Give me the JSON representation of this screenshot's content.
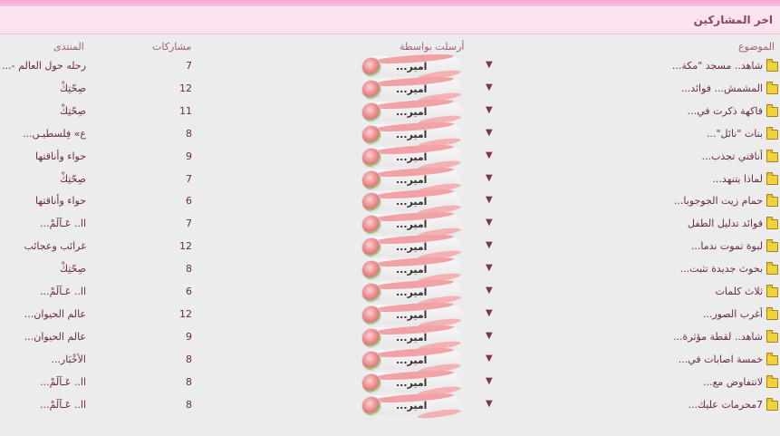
{
  "header": {
    "title": "اخر المشاركين"
  },
  "columns": {
    "topic": "الموضوع",
    "poster": "أرسلت بواسطة",
    "posts": "مشاركات",
    "forum": "المنتدى"
  },
  "rows": [
    {
      "topic": "شاهد.. مسجد \"مكة...",
      "poster": "امير...",
      "posts": "7",
      "forum": "رحله حول العالم -..."
    },
    {
      "topic": "المشمش... فوائد...",
      "poster": "امير...",
      "posts": "12",
      "forum": "صِحّتِكْ"
    },
    {
      "topic": "فاكهة ذكرت في...",
      "poster": "امير...",
      "posts": "11",
      "forum": "صِحّتِكْ"
    },
    {
      "topic": "بنات \"نائل\"...",
      "poster": "امير...",
      "posts": "8",
      "forum": "ﻉ» فِلسطيـﮟ..."
    },
    {
      "topic": "أناقتي تجذب...",
      "poster": "امير...",
      "posts": "9",
      "forum": "حواء وأناقتها"
    },
    {
      "topic": "لماذا يتنهد...",
      "poster": "امير...",
      "posts": "7",
      "forum": "صِحّتِكْ"
    },
    {
      "topic": "حمام زيت الجوجوبا...",
      "poster": "امير...",
      "posts": "6",
      "forum": "حواء وأناقتها"
    },
    {
      "topic": "فوائد تدليل الطفل",
      "poster": "امير...",
      "posts": "7",
      "forum": "اا.. عَـآلَمْ..."
    },
    {
      "topic": "لبوة تموت ندما...",
      "poster": "امير...",
      "posts": "12",
      "forum": "غرائب وعجائب"
    },
    {
      "topic": "بحوث جديدة تثبت...",
      "poster": "امير...",
      "posts": "8",
      "forum": "صِحّتِكْ"
    },
    {
      "topic": "ثلاث كلمات",
      "poster": "امير...",
      "posts": "6",
      "forum": "اا.. عَـآلَمْ..."
    },
    {
      "topic": "أغرب الصور...",
      "poster": "امير...",
      "posts": "12",
      "forum": "عالم الحيوان..."
    },
    {
      "topic": "شاهد.. لقطة مؤثرة...",
      "poster": "امير...",
      "posts": "9",
      "forum": "عالم الحيوان..."
    },
    {
      "topic": "خمسة اصابات في...",
      "poster": "امير...",
      "posts": "8",
      "forum": "الأخْبَار..."
    },
    {
      "topic": "لاتتفاوض مع...",
      "poster": "امير...",
      "posts": "8",
      "forum": "اا.. عَـآلَمْ..."
    },
    {
      "topic": "7محرمات عليك...",
      "poster": "امير...",
      "posts": "8",
      "forum": "اا.. عَـآلَمْ..."
    }
  ],
  "icons": {
    "topic": "folder-icon",
    "menu": "triangle-down-icon",
    "poster": "user-avatar"
  },
  "colors": {
    "accent": "#f5a6d0",
    "header_bg": "#fbe3f0",
    "text": "#6b2a46"
  }
}
